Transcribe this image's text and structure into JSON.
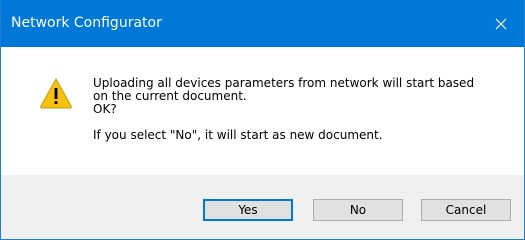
{
  "window": {
    "title": "Network Configurator",
    "accent_color": "#0078d7"
  },
  "icons": {
    "close": "close-icon",
    "warning": "warning-icon"
  },
  "message": {
    "line1": "Uploading all devices parameters from network will start based",
    "line2": "on the current document.",
    "line3": "OK?",
    "line4": "If you select \"No\", it will start as new document."
  },
  "buttons": {
    "yes": "Yes",
    "no": "No",
    "cancel": "Cancel"
  }
}
